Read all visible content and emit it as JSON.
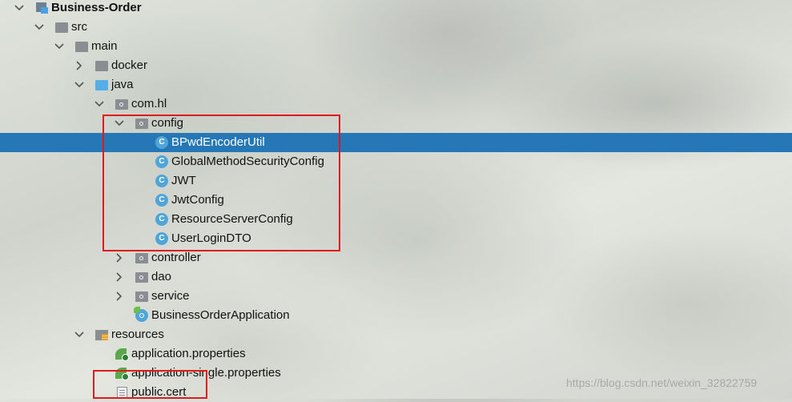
{
  "project_tree": {
    "items": [
      {
        "id": "business-order",
        "label": "Business-Order",
        "depth": 0,
        "expanded": true,
        "icon": "module-icon",
        "bold": true
      },
      {
        "id": "src",
        "label": "src",
        "depth": 1,
        "expanded": true,
        "icon": "folder-icon"
      },
      {
        "id": "main",
        "label": "main",
        "depth": 2,
        "expanded": true,
        "icon": "folder-icon"
      },
      {
        "id": "docker",
        "label": "docker",
        "depth": 3,
        "expanded": false,
        "icon": "folder-icon"
      },
      {
        "id": "java",
        "label": "java",
        "depth": 3,
        "expanded": true,
        "icon": "source-folder-icon"
      },
      {
        "id": "com-hl",
        "label": "com.hl",
        "depth": 4,
        "expanded": true,
        "icon": "package-icon"
      },
      {
        "id": "config",
        "label": "config",
        "depth": 5,
        "expanded": true,
        "icon": "package-icon"
      },
      {
        "id": "bpwd-encoder-util",
        "label": "BPwdEncoderUtil",
        "depth": 6,
        "icon": "class-icon",
        "selected": true
      },
      {
        "id": "global-method-security-config",
        "label": "GlobalMethodSecurityConfig",
        "depth": 6,
        "icon": "class-icon"
      },
      {
        "id": "jwt",
        "label": "JWT",
        "depth": 6,
        "icon": "class-icon"
      },
      {
        "id": "jwt-config",
        "label": "JwtConfig",
        "depth": 6,
        "icon": "class-icon"
      },
      {
        "id": "resource-server-config",
        "label": "ResourceServerConfig",
        "depth": 6,
        "icon": "class-icon"
      },
      {
        "id": "user-login-dto",
        "label": "UserLoginDTO",
        "depth": 6,
        "icon": "class-icon"
      },
      {
        "id": "controller",
        "label": "controller",
        "depth": 5,
        "expanded": false,
        "icon": "package-icon"
      },
      {
        "id": "dao",
        "label": "dao",
        "depth": 5,
        "expanded": false,
        "icon": "package-icon"
      },
      {
        "id": "service",
        "label": "service",
        "depth": 5,
        "expanded": false,
        "icon": "package-icon"
      },
      {
        "id": "business-order-application",
        "label": "BusinessOrderApplication",
        "depth": 5,
        "icon": "spring-boot-app-icon"
      },
      {
        "id": "resources",
        "label": "resources",
        "depth": 3,
        "expanded": true,
        "icon": "resources-folder-icon"
      },
      {
        "id": "application-properties",
        "label": "application.properties",
        "depth": 4,
        "icon": "spring-properties-icon"
      },
      {
        "id": "application-single-properties",
        "label": "application-single.properties",
        "depth": 4,
        "icon": "spring-properties-icon"
      },
      {
        "id": "public-cert",
        "label": "public.cert",
        "depth": 4,
        "icon": "file-icon"
      }
    ],
    "class_icon_letter": "C"
  },
  "highlights": [
    {
      "id": "config-highlight",
      "color": "#e0191c"
    },
    {
      "id": "public-cert-highlight",
      "color": "#e0191c"
    }
  ],
  "watermark": "https://blog.csdn.net/weixin_32822759",
  "colors": {
    "selection": "#2677b5",
    "class_icon": "#4fa5d8",
    "source_folder": "#55aee8",
    "folder": "#8a8e92",
    "highlight": "#e0191c"
  }
}
